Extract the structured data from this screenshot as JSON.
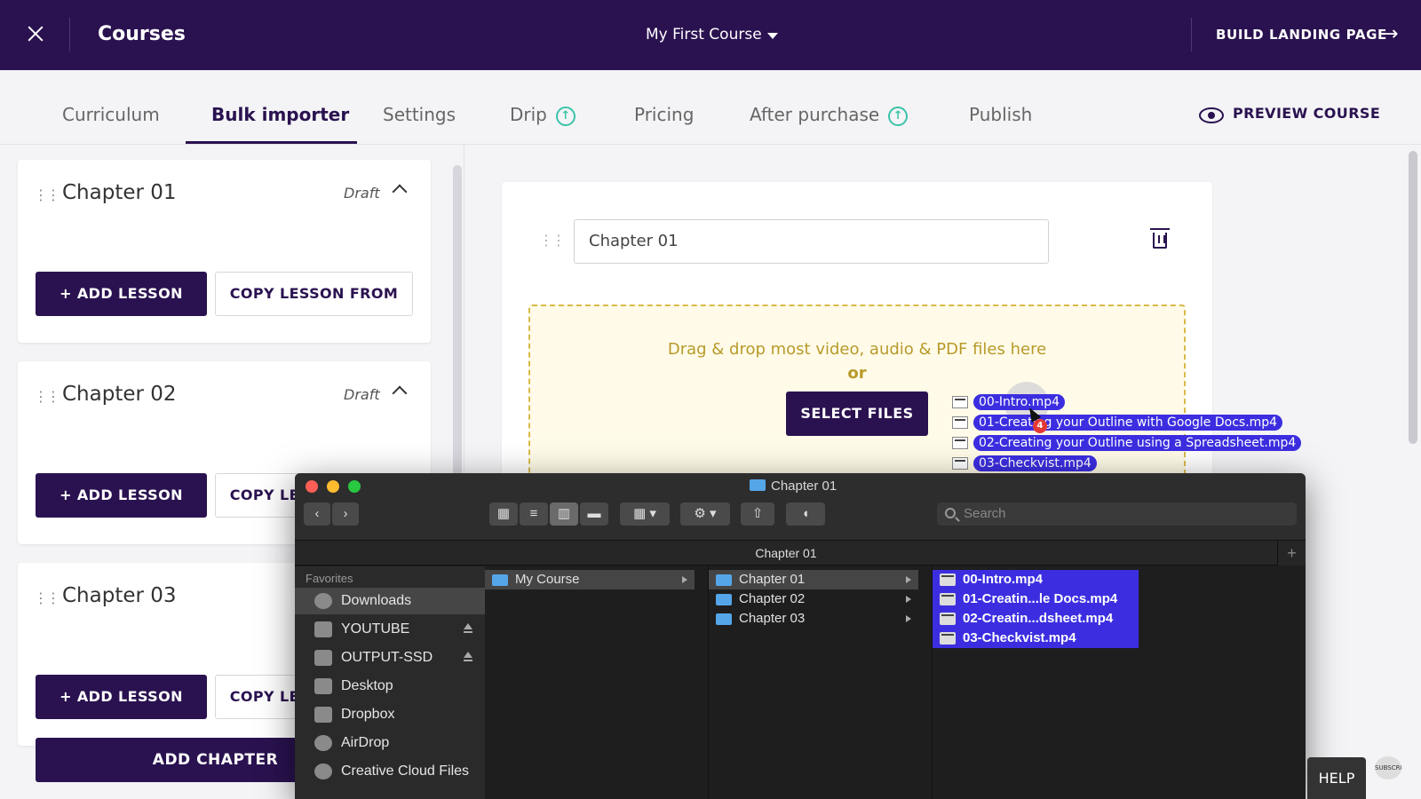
{
  "header": {
    "title": "Courses",
    "course_name": "My First Course",
    "build_label": "BUILD LANDING PAGE",
    "arrow": "→"
  },
  "tabs": [
    {
      "label": "Curriculum"
    },
    {
      "label": "Bulk importer",
      "active": true
    },
    {
      "label": "Settings"
    },
    {
      "label": "Drip",
      "icon": "upgrade-icon"
    },
    {
      "label": "Pricing"
    },
    {
      "label": "After purchase",
      "icon": "upgrade-icon"
    },
    {
      "label": "Publish"
    }
  ],
  "preview_label": "PREVIEW COURSE",
  "chapters": [
    {
      "title": "Chapter 01",
      "status": "Draft",
      "add": "+ ADD LESSON",
      "copy": "COPY LESSON FROM"
    },
    {
      "title": "Chapter 02",
      "status": "Draft",
      "add": "+ ADD LESSON",
      "copy": "COPY LESSON FROM"
    },
    {
      "title": "Chapter 03",
      "add": "+ ADD LESSON",
      "copy": "COPY LESSON FROM"
    }
  ],
  "add_chapter": "ADD CHAPTER",
  "editor": {
    "chapter_name": "Chapter 01",
    "drop_hint": "Drag & drop most video, audio & PDF files here",
    "or": "or",
    "select_files": "SELECT FILES"
  },
  "drag": {
    "files": [
      "00-Intro.mp4",
      "01-Creating your Outline with Google Docs.mp4",
      "02-Creating your Outline using a Spreadsheet.mp4",
      "03-Checkvist.mp4"
    ],
    "count_badge": "4"
  },
  "finder": {
    "window_title": "Chapter 01",
    "path": "Chapter 01",
    "search_placeholder": "Search",
    "favorites_label": "Favorites",
    "sidebar": [
      "Downloads",
      "YOUTUBE",
      "OUTPUT-SSD",
      "Desktop",
      "Dropbox",
      "AirDrop",
      "Creative Cloud Files"
    ],
    "col1": [
      "My Course"
    ],
    "col2": [
      "Chapter 01",
      "Chapter 02",
      "Chapter 03"
    ],
    "col3": [
      "00-Intro.mp4",
      "01-Creatin...le Docs.mp4",
      "02-Creatin...dsheet.mp4",
      "03-Checkvist.mp4"
    ],
    "colors": {
      "red": "#ff5f57",
      "yellow": "#febc2e",
      "green": "#28c840",
      "selection": "#3c2ee0"
    }
  },
  "help_label": "HELP",
  "subscribe_label": "SUBSCRIBE",
  "colors": {
    "brand": "#2a1250",
    "accent": "#3cc3a8"
  }
}
